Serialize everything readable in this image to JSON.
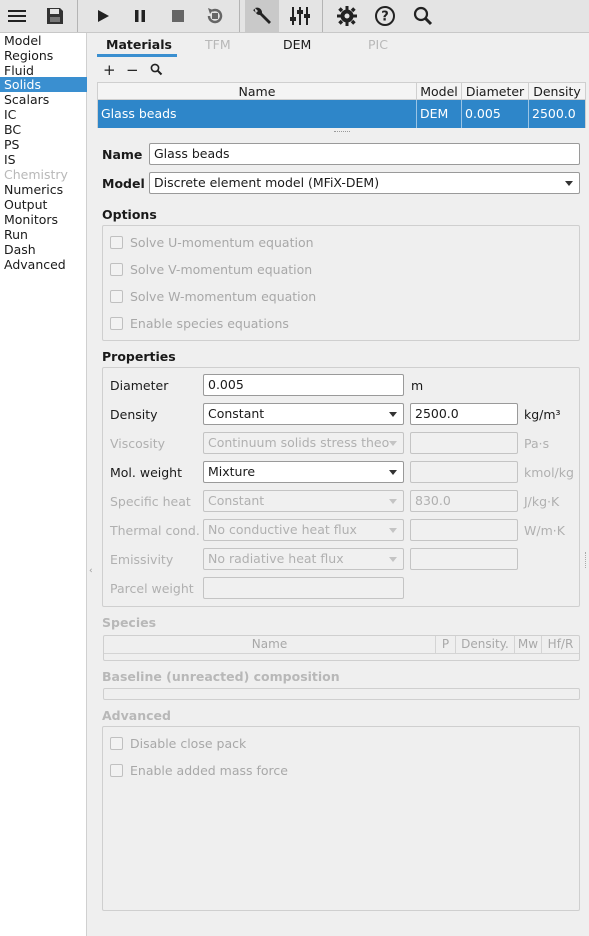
{
  "toolbar": {
    "icons": [
      "menu-icon",
      "save-icon",
      "play-icon",
      "pause-icon",
      "stop-icon",
      "reset-icon",
      "wrench-icon",
      "sliders-icon",
      "gear-icon",
      "help-icon",
      "search-icon"
    ]
  },
  "nav": {
    "items": [
      {
        "label": "Model"
      },
      {
        "label": "Regions"
      },
      {
        "label": "Fluid"
      },
      {
        "label": "Solids",
        "active": true
      },
      {
        "label": "Scalars"
      },
      {
        "label": "IC"
      },
      {
        "label": "BC"
      },
      {
        "label": "PS"
      },
      {
        "label": "IS"
      },
      {
        "label": "Chemistry",
        "disabled": true
      },
      {
        "label": "Numerics"
      },
      {
        "label": "Output"
      },
      {
        "label": "Monitors"
      },
      {
        "label": "Run"
      },
      {
        "label": "Dash"
      },
      {
        "label": "Advanced"
      }
    ]
  },
  "tabs": [
    "Materials",
    "TFM",
    "DEM",
    "PIC"
  ],
  "materials_table": {
    "columns": [
      "Name",
      "Model",
      "Diameter",
      "Density"
    ],
    "rows": [
      {
        "name": "Glass beads",
        "model": "DEM",
        "diameter": "0.005",
        "density": "2500.0"
      }
    ]
  },
  "form": {
    "name_label": "Name",
    "name_value": "Glass beads",
    "model_label": "Model",
    "model_value": "Discrete element model (MFiX-DEM)"
  },
  "options": {
    "title": "Options",
    "items": [
      "Solve U-momentum equation",
      "Solve V-momentum equation",
      "Solve W-momentum equation",
      "Enable species equations"
    ]
  },
  "properties": {
    "title": "Properties",
    "diameter": {
      "label": "Diameter",
      "value": "0.005",
      "unit": "m"
    },
    "density": {
      "label": "Density",
      "option": "Constant",
      "value": "2500.0",
      "unit": "kg/m³"
    },
    "viscosity": {
      "label": "Viscosity",
      "option": "Continuum solids stress theo",
      "value": "",
      "unit": "Pa⋅s"
    },
    "mol_weight": {
      "label": "Mol. weight",
      "option": "Mixture",
      "value": "",
      "unit": "kmol/kg"
    },
    "specific_heat": {
      "label": "Specific heat",
      "option": "Constant",
      "value": "830.0",
      "unit": "J/kg⋅K"
    },
    "thermal_cond": {
      "label": "Thermal cond.",
      "option": "No conductive heat flux",
      "value": "",
      "unit": "W/m⋅K"
    },
    "emissivity": {
      "label": "Emissivity",
      "option": "No radiative heat flux",
      "value": ""
    },
    "parcel_weight": {
      "label": "Parcel weight",
      "value": ""
    }
  },
  "species": {
    "title": "Species",
    "columns": [
      "Name",
      "P",
      "Density.",
      "Mw",
      "Hf/R"
    ]
  },
  "baseline": {
    "title": "Baseline (unreacted) composition"
  },
  "advanced": {
    "title": "Advanced",
    "items": [
      "Disable close pack",
      "Enable added mass force"
    ]
  },
  "colors": {
    "accent": "#3a8fd0",
    "selection": "#2e86c9"
  }
}
